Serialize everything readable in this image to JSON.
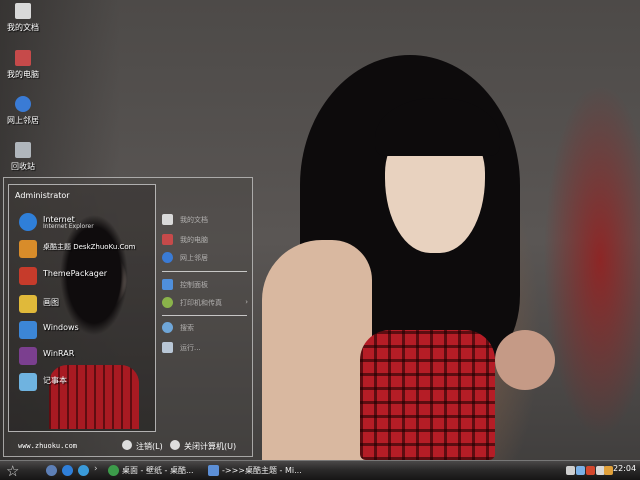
{
  "desktop_icons": [
    {
      "label": "我的文档",
      "icon": "my-documents-icon",
      "color": "#d9d9d9"
    },
    {
      "label": "我的电脑",
      "icon": "my-computer-icon",
      "color": "#c64a4a"
    },
    {
      "label": "网上邻居",
      "icon": "network-places-icon",
      "color": "#3a7bd5"
    },
    {
      "label": "回收站",
      "icon": "recycle-bin-icon",
      "color": "#b0b6bc"
    }
  ],
  "start_menu": {
    "user_name": "Administrator",
    "programs": [
      {
        "label": "Internet",
        "sublabel": "Internet Explorer",
        "icon": "internet-explorer-icon",
        "color": "#2f7fd9"
      },
      {
        "label": "桌酷主题 DeskZhuoKu.Com",
        "sublabel": "",
        "icon": "zhuoku-theme-icon",
        "color": "#d88c2a"
      },
      {
        "label": "ThemePackager",
        "sublabel": "",
        "icon": "theme-packager-icon",
        "color": "#c63b2b"
      },
      {
        "label": "画图",
        "sublabel": "",
        "icon": "paint-icon",
        "color": "#e0b93a"
      },
      {
        "label": "Windows",
        "sublabel": "",
        "icon": "monitor-icon",
        "color": "#3c86d6"
      },
      {
        "label": "WinRAR",
        "sublabel": "",
        "icon": "winrar-icon",
        "color": "#7b3f8f"
      },
      {
        "label": "记事本",
        "sublabel": "",
        "icon": "notepad-icon",
        "color": "#6fb3e0"
      }
    ],
    "places": [
      {
        "label": "我的文档",
        "icon": "my-documents-icon",
        "color": "#d9d9d9"
      },
      {
        "label": "我的电脑",
        "icon": "my-computer-icon",
        "color": "#c64a4a"
      },
      {
        "label": "网上邻居",
        "icon": "network-places-icon",
        "color": "#3a7bd5"
      },
      {
        "label": "控制面板",
        "icon": "control-panel-icon",
        "color": "#4f8fdc"
      },
      {
        "label": "打印机和传真",
        "icon": "printer-icon",
        "color": "#8ab34a"
      },
      {
        "label": "搜索",
        "icon": "search-icon",
        "color": "#6fa6d8"
      },
      {
        "label": "运行...",
        "icon": "run-icon",
        "color": "#b9c7d6"
      }
    ],
    "website": "www.zhuoku.com",
    "logoff_label": "注销(L)",
    "shutdown_label": "关闭计算机(U)"
  },
  "taskbar": {
    "start_glyph": "☆",
    "quick_launch": [
      {
        "icon": "show-desktop-icon",
        "color": "#5d7fb6"
      },
      {
        "icon": "ie-quick-icon",
        "color": "#2f7fd9"
      },
      {
        "icon": "media-player-icon",
        "color": "#3a9ad9"
      }
    ],
    "overflow_glyph": "›",
    "tasks": [
      {
        "label": "桌面 - 壁纸 - 桌酷...",
        "icon": "browser-task-icon",
        "color": "#3c9b4a"
      },
      {
        "label": "->>>桌酷主题 - Mi...",
        "icon": "document-task-icon",
        "color": "#5c8fd6"
      }
    ],
    "tray_icons": [
      {
        "icon": "arrow-tray-icon",
        "color": "#cfcfcf"
      },
      {
        "icon": "network-tray-icon",
        "color": "#7ab0e6"
      },
      {
        "icon": "security-tray-icon",
        "color": "#d4482e"
      },
      {
        "icon": "volume-tray-icon",
        "color": "#d8d8d8"
      },
      {
        "icon": "input-tray-icon",
        "color": "#e0a03a"
      }
    ],
    "clock": "22:04"
  }
}
